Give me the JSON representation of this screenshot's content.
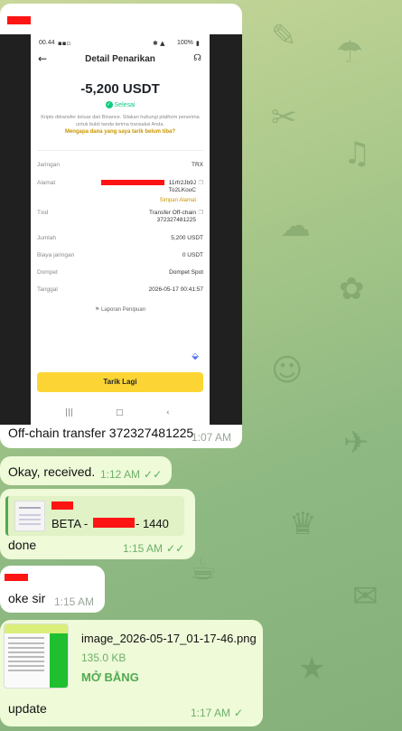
{
  "colors": {
    "incoming_bubble": "#ffffff",
    "outgoing_bubble": "#eefad8",
    "binance_yellow": "#fcd535",
    "success_green": "#0ecb81",
    "link_gold": "#c99400",
    "open_file_green": "#52a94f",
    "redaction": "#ff1414"
  },
  "screenshot": {
    "status_bar": {
      "time": "00.44",
      "battery": "100%"
    },
    "header": {
      "title": "Detail Penarikan",
      "back_icon": "arrow-left-icon",
      "support_icon": "headset-icon"
    },
    "amount": "-5,200 USDT",
    "status": "Selesai",
    "info_text": "Kripto ditransfer keluar dari Binance. Silakan hubungi platform penerima untuk bukti tanda terima transaksi Anda.",
    "why_link": "Mengapa dana yang saya tarik belum tiba?",
    "rows": [
      {
        "label": "Jaringan",
        "value": "TRX"
      },
      {
        "label": "Alamat",
        "value_line1": "11rfr2Jb9J",
        "value_line2": "To2LKouC",
        "link": "Simpan Alamat"
      },
      {
        "label": "Txid",
        "value_line1": "Transfer Off-chain",
        "value_line2": "372327481225"
      },
      {
        "label": "Jumlah",
        "value": "5,200 USDT"
      },
      {
        "label": "Biaya jaringan",
        "value": "0 USDT"
      },
      {
        "label": "Dompet",
        "value": "Dompet Spot"
      },
      {
        "label": "Tanggal",
        "value": "2026-05-17 00:41:57"
      }
    ],
    "report_link": "Laporan Penipuan",
    "button": "Tarik Lagi"
  },
  "messages": [
    {
      "direction": "in",
      "text": "Off-chain transfer 372327481225",
      "time": "1:07 AM"
    },
    {
      "direction": "out",
      "text": "Okay, received.",
      "time": "1:12 AM"
    },
    {
      "direction": "out",
      "reply_snippet": "BETA - ",
      "reply_suffix": "- 1440",
      "text": "done",
      "time": "1:15 AM"
    },
    {
      "direction": "in",
      "text": "oke sir",
      "time": "1:15 AM"
    },
    {
      "direction": "out",
      "file_name": "image_2026-05-17_01-17-46.png",
      "file_size": "135.0 KB",
      "file_action": "MỞ BẰNG",
      "text": "update",
      "time": "1:17 AM"
    }
  ]
}
